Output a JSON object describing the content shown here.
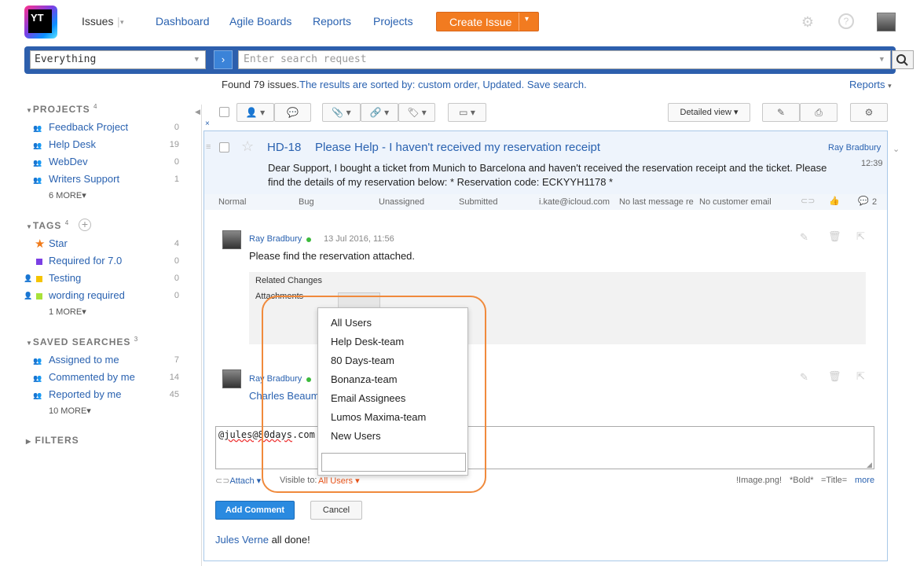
{
  "brand": {
    "logo_text": "YT"
  },
  "nav": {
    "issues": "Issues",
    "dashboard": "Dashboard",
    "agile": "Agile Boards",
    "reports": "Reports",
    "projects": "Projects",
    "create_issue": "Create Issue"
  },
  "search": {
    "context": "Everything",
    "placeholder": "Enter search request"
  },
  "results": {
    "found": "Found 79 issues.",
    "sorted_prefix": "The results are sorted by:",
    "sort_fields": "custom order, Updated.",
    "save_search": "Save search.",
    "reports_link": "Reports"
  },
  "sidebar": {
    "projects": {
      "title": "PROJECTS",
      "count": "4",
      "items": [
        {
          "label": "Feedback Project",
          "count": "0"
        },
        {
          "label": "Help Desk",
          "count": "19"
        },
        {
          "label": "WebDev",
          "count": "0"
        },
        {
          "label": "Writers Support",
          "count": "1"
        }
      ],
      "more": "6 MORE"
    },
    "tags": {
      "title": "TAGS",
      "count": "4",
      "items": [
        {
          "label": "Star",
          "count": "4",
          "color": "#f07a1a"
        },
        {
          "label": "Required for 7.0",
          "count": "0",
          "color": "#7b3fe4"
        },
        {
          "label": "Testing",
          "count": "0",
          "color": "#f5c400"
        },
        {
          "label": "wording required",
          "count": "0",
          "color": "#a8e23a"
        }
      ],
      "more": "1 MORE"
    },
    "saved": {
      "title": "SAVED SEARCHES",
      "count": "3",
      "items": [
        {
          "label": "Assigned to me",
          "count": "7"
        },
        {
          "label": "Commented by me",
          "count": "14"
        },
        {
          "label": "Reported by me",
          "count": "45"
        }
      ],
      "more": "10 MORE"
    },
    "filters": {
      "title": "FILTERS"
    }
  },
  "toolbar": {
    "view": "Detailed view"
  },
  "issue": {
    "id": "HD-18",
    "title": "Please Help - I haven't received my reservation receipt",
    "reporter": "Ray Bradbury",
    "time": "12:39",
    "description": "Dear Support, I bought a ticket from Munich to Barcelona and haven't received the reservation receipt and the ticket. Please find the details of my reservation below: * Reservation code: ECKYYH1178 *",
    "meta": {
      "priority": "Normal",
      "type": "Bug",
      "assignee": "Unassigned",
      "state": "Submitted",
      "email": "i.kate@icloud.com",
      "last_message": "No last message re",
      "customer_email": "No customer email",
      "comments": "2"
    }
  },
  "comments": [
    {
      "author": "Ray Bradbury",
      "date": "13 Jul 2016, 11:56",
      "text": "Please find the reservation attached."
    },
    {
      "author": "Ray Bradbury",
      "text": "Charles Beaum"
    }
  ],
  "related": {
    "title": "Related Changes",
    "attachments": "Attachments"
  },
  "editor": {
    "text_prefix": "@",
    "text_mention": "jules@80days",
    "text_suffix": ".com",
    "attach": "Attach",
    "visible_to_label": "Visible to:",
    "visible_to_value": "All Users",
    "hint_image": "!Image.png!",
    "hint_bold": "*Bold*",
    "hint_title": "=Title=",
    "more": "more",
    "add_comment": "Add Comment",
    "cancel": "Cancel"
  },
  "visibility_dropdown": {
    "options": [
      "All Users",
      "Help Desk-team",
      "80 Days-team",
      "Bonanza-team",
      "Email Assignees",
      "Lumos Maxima-team",
      "New Users"
    ]
  },
  "footer": {
    "author": "Jules Verne",
    "text": "all done!"
  }
}
